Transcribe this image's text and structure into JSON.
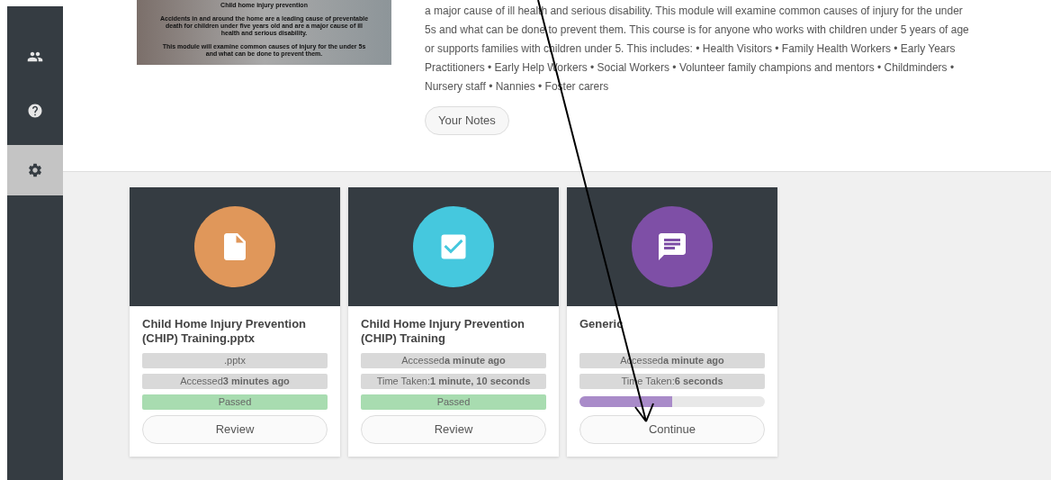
{
  "sidebar": {
    "items": [
      {
        "selected": false
      },
      {
        "selected": false
      },
      {
        "selected": true
      }
    ]
  },
  "module": {
    "slide": {
      "title": "Child home injury prevention",
      "paragraphs": [
        "Accidents in and around the home are a leading cause of preventable death for children under five years old and are a major cause of ill health and serious disability.",
        "This module will examine common causes of injury for the under 5s and what can be done to prevent them."
      ]
    },
    "description": "a major cause of ill health and serious disability.  This module will examine common causes of injury for the under 5s and what can be done to prevent them.  This course is for anyone who works with children under 5 years of age or supports families with children under 5.  This includes: • Health Visitors • Family Health Workers • Early Years Practitioners • Early Help Workers • Social Workers • Volunteer family champions and mentors • Childminders • Nursery staff • Nannies • Foster carers",
    "notes_button": "Your Notes"
  },
  "cards": [
    {
      "color": "#e0975a",
      "title": "Child Home Injury Prevention (CHIP) Training.pptx",
      "rows": [
        {
          "kind": "info",
          "text": ".pptx"
        },
        {
          "kind": "info",
          "text": "Accessed**3 minutes ago**"
        },
        {
          "kind": "status",
          "text": "Passed"
        }
      ],
      "button": "Review"
    },
    {
      "color": "#45c8de",
      "title": "Child Home Injury Prevention (CHIP) Training",
      "rows": [
        {
          "kind": "info",
          "text": "Accessed**a minute ago**"
        },
        {
          "kind": "info",
          "text": "Time Taken:**1 minute, 10 seconds**"
        },
        {
          "kind": "status",
          "text": "Passed"
        }
      ],
      "button": "Review"
    },
    {
      "color": "#7e4fa6",
      "title": "Generic",
      "rows": [
        {
          "kind": "info",
          "text": "Accessed**a minute ago**"
        },
        {
          "kind": "info",
          "text": "Time Taken:**6 seconds**"
        },
        {
          "kind": "progress",
          "level": 0.5
        }
      ],
      "button": "Continue"
    }
  ]
}
